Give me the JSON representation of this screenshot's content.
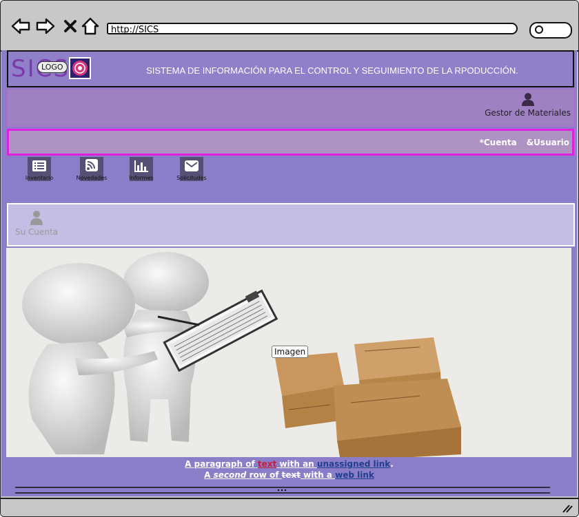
{
  "browser": {
    "url": "http://SICS",
    "nav_icons": [
      "back-icon",
      "forward-icon",
      "close-icon",
      "home-icon"
    ]
  },
  "header": {
    "logo_text": "SICS",
    "logo_badge": "LOGO",
    "title": "SISTEMA DE INFORMACIÓN PARA EL CONTROL Y SEGUIMIENTO DE LA RPODUCCIÓN."
  },
  "user_band": {
    "role": "Gestor de Materiales"
  },
  "account_band": {
    "cuenta": "*Cuenta",
    "usuario": "&Usuario"
  },
  "tiles": [
    {
      "label": "Inventario",
      "icon": "list-icon"
    },
    {
      "label": "Novedades",
      "icon": "rss-icon"
    },
    {
      "label": "Informes",
      "icon": "bar-chart-icon"
    },
    {
      "label": "Solicitudes",
      "icon": "envelope-icon"
    }
  ],
  "cuenta_panel": {
    "label": "Su Cuenta"
  },
  "hero": {
    "image_label": "Imagen"
  },
  "paragraph": {
    "l1_a": "A paragraph of ",
    "l1_text": "text",
    "l1_b": " with an ",
    "l1_link": "unassigned link",
    "l1_c": ".",
    "l2_a": "A ",
    "l2_second": "second",
    "l2_b": " row of ",
    "l2_text": "text",
    "l2_c": " with a ",
    "l2_link": "web link"
  },
  "colors": {
    "page_bg": "#8c7dc9",
    "band_border": "#e020e0",
    "red_text": "#c21c37",
    "link_blue": "#1e3f8e"
  }
}
